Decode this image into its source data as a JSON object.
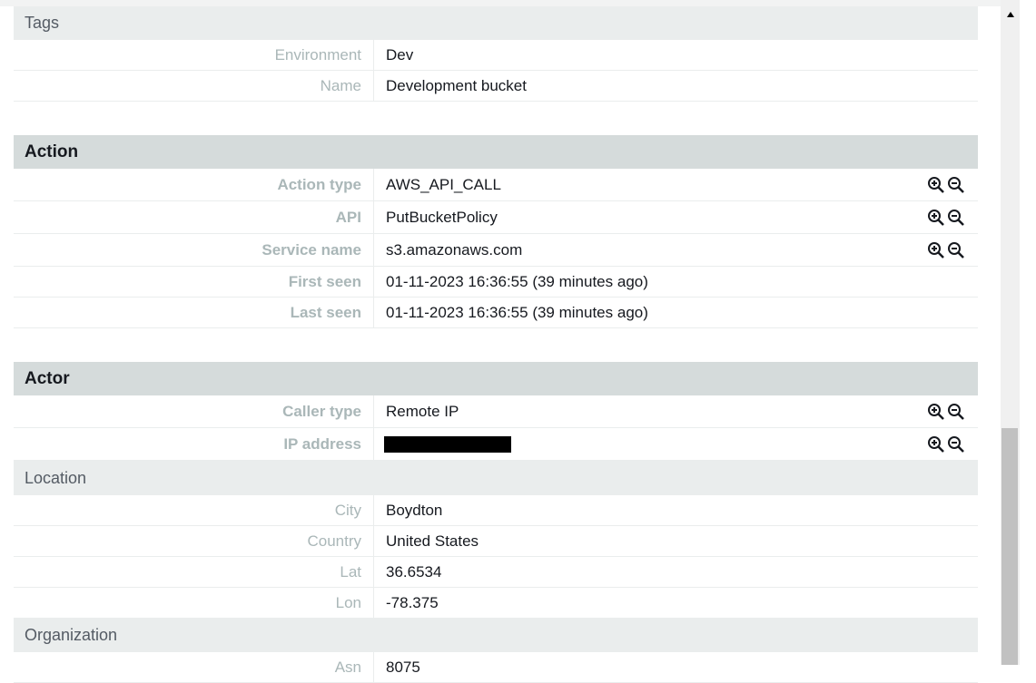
{
  "tags": {
    "header": "Tags",
    "rows": [
      {
        "label": "Environment",
        "value": "Dev"
      },
      {
        "label": "Name",
        "value": "Development bucket"
      }
    ]
  },
  "action": {
    "header": "Action",
    "rows": [
      {
        "label": "Action type",
        "value": "AWS_API_CALL"
      },
      {
        "label": "API",
        "value": "PutBucketPolicy"
      },
      {
        "label": "Service name",
        "value": "s3.amazonaws.com"
      },
      {
        "label": "First seen",
        "value": "01-11-2023 16:36:55 (39 minutes ago)"
      },
      {
        "label": "Last seen",
        "value": "01-11-2023 16:36:55 (39 minutes ago)"
      }
    ]
  },
  "actor": {
    "header": "Actor",
    "rows": [
      {
        "label": "Caller type",
        "value": "Remote IP"
      },
      {
        "label": "IP address",
        "value": ""
      }
    ]
  },
  "location": {
    "header": "Location",
    "rows": [
      {
        "label": "City",
        "value": "Boydton"
      },
      {
        "label": "Country",
        "value": "United States"
      },
      {
        "label": "Lat",
        "value": "36.6534"
      },
      {
        "label": "Lon",
        "value": "-78.375"
      }
    ]
  },
  "organization": {
    "header": "Organization",
    "rows": [
      {
        "label": "Asn",
        "value": "8075"
      }
    ]
  },
  "icons": {
    "zoom_in": "zoom-in-icon",
    "zoom_out": "zoom-out-icon"
  }
}
